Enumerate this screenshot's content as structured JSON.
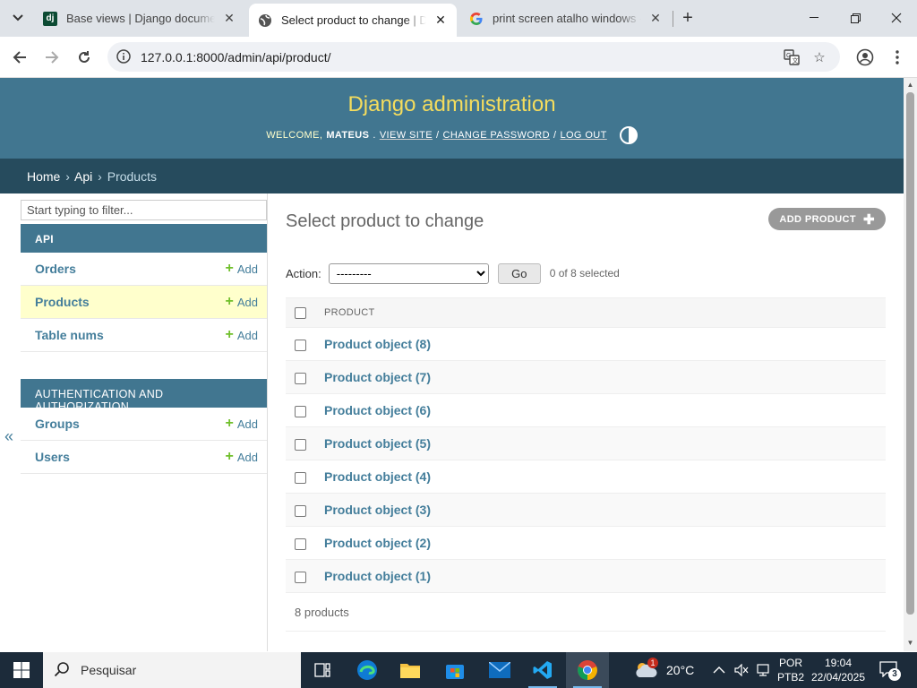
{
  "browser": {
    "tabs": [
      {
        "title": "Base views | Django documenta",
        "favicon": "django-favicon"
      },
      {
        "title": "Select product to change | Djan",
        "favicon": "globe-icon",
        "active": true
      },
      {
        "title": "print screen atalho windows - P",
        "favicon": "google-icon"
      }
    ],
    "url": "127.0.0.1:8000/admin/api/product/"
  },
  "header": {
    "site_name": "Django administration",
    "welcome": "WELCOME,",
    "username": "MATEUS",
    "view_site": "VIEW SITE",
    "change_password": "CHANGE PASSWORD",
    "log_out": "LOG OUT",
    "separator": "/"
  },
  "breadcrumbs": {
    "home": "Home",
    "app": "Api",
    "current": "Products",
    "sep": "›"
  },
  "sidebar": {
    "filter_placeholder": "Start typing to filter...",
    "collapse_glyph": "«",
    "modules": [
      {
        "caption": "API",
        "models": [
          {
            "name": "Orders",
            "add": "Add"
          },
          {
            "name": "Products",
            "add": "Add",
            "current": true
          },
          {
            "name": "Table nums",
            "add": "Add"
          }
        ]
      },
      {
        "caption": "AUTHENTICATION AND AUTHORIZATION",
        "models": [
          {
            "name": "Groups",
            "add": "Add"
          },
          {
            "name": "Users",
            "add": "Add"
          }
        ]
      }
    ]
  },
  "content": {
    "title": "Select product to change",
    "add_button": "ADD PRODUCT",
    "action_label": "Action:",
    "action_selected": "---------",
    "go_label": "Go",
    "selection_counter": "0 of 8 selected",
    "column_header": "PRODUCT",
    "rows": [
      "Product object (8)",
      "Product object (7)",
      "Product object (6)",
      "Product object (5)",
      "Product object (4)",
      "Product object (3)",
      "Product object (2)",
      "Product object (1)"
    ],
    "paginator": "8 products"
  },
  "taskbar": {
    "search_placeholder": "Pesquisar",
    "weather": "20°C",
    "weather_badge": "1",
    "language": "POR",
    "layout": "PTB2",
    "time": "19:04",
    "date": "22/04/2025",
    "notifications": "3"
  },
  "colors": {
    "header": "#417690",
    "breadcrumbs": "#264b5d",
    "branding": "#f5dd5d",
    "link": "#447e9b",
    "add_plus": "#70bf2b",
    "current_row": "#ffffcc"
  }
}
